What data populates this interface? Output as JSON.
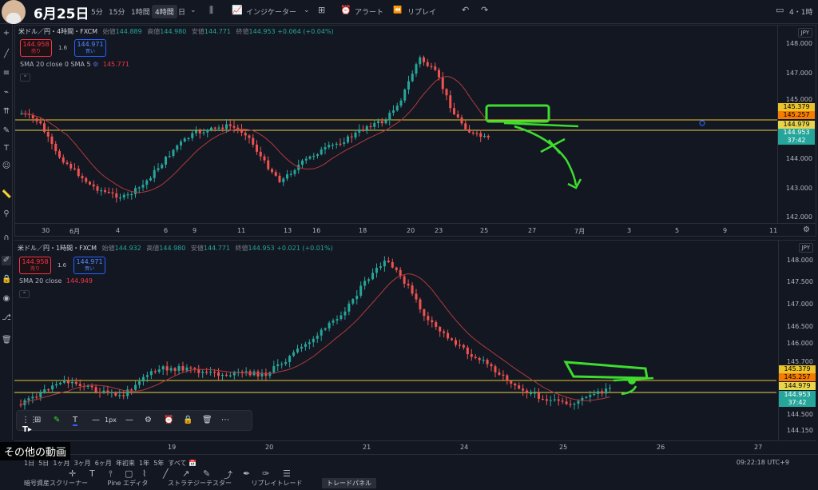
{
  "header": {
    "date_title": "6月25日",
    "timeframes": [
      "5分",
      "15分",
      "1時間",
      "4時間",
      "日"
    ],
    "active_timeframe": "4時間",
    "indicators_label": "インジケーター",
    "alert_label": "アラート",
    "replay_label": "リプレイ",
    "layout_label": "4・1時"
  },
  "pane1": {
    "symbol": "米ドル／円・4時間・FXCM",
    "open_label": "始値",
    "open": "144.889",
    "high_label": "高値",
    "high": "144.980",
    "low_label": "安値",
    "low": "144.771",
    "close_label": "終値",
    "close": "144.953",
    "change": "+0.064 (+0.04%)",
    "sell_price": "144.958",
    "sell_label": "売り",
    "spread": "1.6",
    "buy_price": "144.971",
    "buy_label": "買い",
    "sma_text": "SMA 20 close 0 SMA 5",
    "sma_value": "145.771",
    "currency": "JPY",
    "y_ticks": [
      "148.000",
      "147.000",
      "145.000",
      "144.000",
      "143.000",
      "142.000"
    ],
    "price_labels": [
      "145.379",
      "145.257",
      "144.979",
      "144.953",
      "37:42"
    ],
    "x_ticks": [
      "30",
      "6月",
      "4",
      "6",
      "9",
      "11",
      "13",
      "16",
      "18",
      "20",
      "23",
      "25",
      "27",
      "7月",
      "3",
      "5",
      "9",
      "11"
    ]
  },
  "pane2": {
    "symbol": "米ドル／円・1時間・FXCM",
    "open_label": "始値",
    "open": "144.932",
    "high_label": "高値",
    "high": "144.980",
    "low_label": "安値",
    "low": "144.771",
    "close_label": "終値",
    "close": "144.953",
    "change": "+0.021 (+0.01%)",
    "sell_price": "144.958",
    "sell_label": "売り",
    "spread": "1.6",
    "buy_price": "144.971",
    "buy_label": "買い",
    "sma_text": "SMA 20 close",
    "sma_value": "144.949",
    "currency": "JPY",
    "y_ticks": [
      "148.000",
      "147.500",
      "147.000",
      "146.500",
      "146.000",
      "145.700",
      "144.500",
      "144.150"
    ],
    "price_labels": [
      "145.379",
      "145.257",
      "144.979",
      "144.953",
      "37:42"
    ],
    "x_ticks": [
      "19",
      "20",
      "21",
      "24",
      "25",
      "26",
      "27"
    ]
  },
  "draw_toolbar": {
    "width_label": "1px"
  },
  "bottom": {
    "ranges": [
      "1日",
      "5日",
      "1ヶ月",
      "3ヶ月",
      "6ヶ月",
      "年初来",
      "1年",
      "5年",
      "すべて"
    ],
    "clock": "09:22:18 UTC+9",
    "tabs": [
      "暗号資産スクリーナー",
      "Pine エディタ",
      "ストラテジーテスター",
      "リプレイトレード",
      "トレードパネル"
    ],
    "active_tab": "トレードパネル"
  },
  "overlay": {
    "other_videos": "その他の動画"
  },
  "colors": {
    "bull": "#26a69a",
    "bear": "#ef5350",
    "sma": "#b23a3a",
    "annotation": "#3ddc2f",
    "background": "#131722"
  }
}
